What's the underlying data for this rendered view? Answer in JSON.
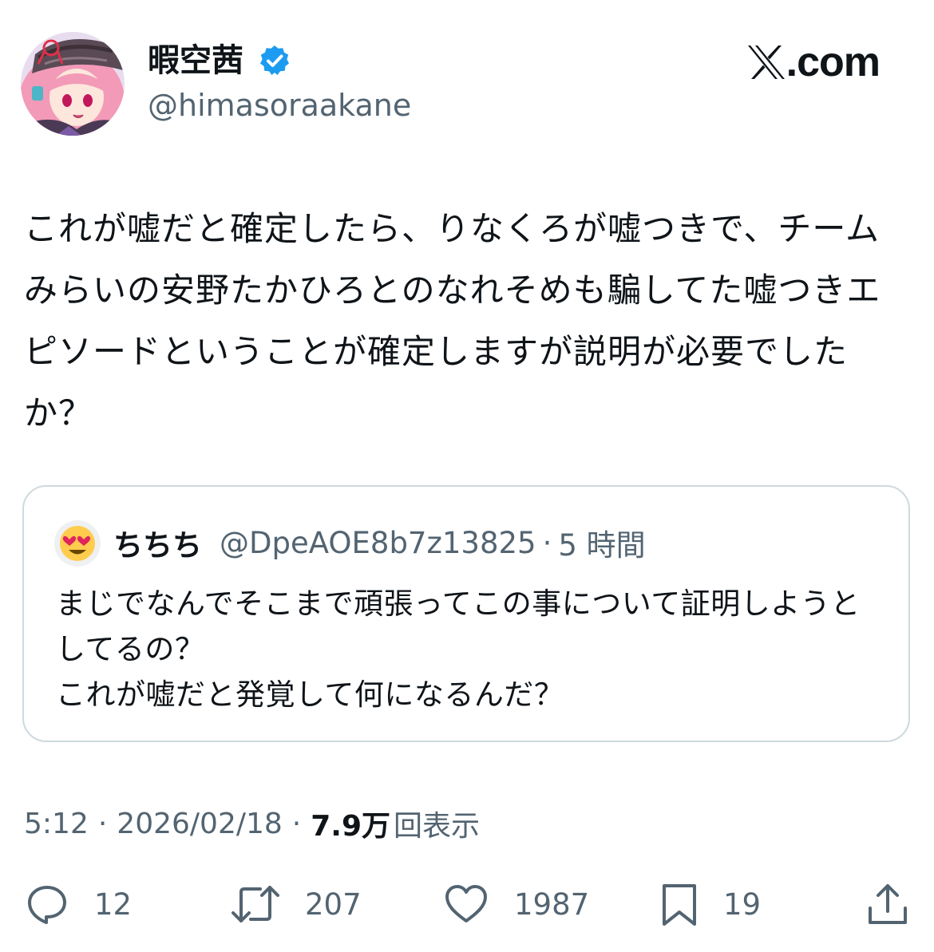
{
  "author": {
    "display_name": "暇空茜",
    "handle": "@himasoraakane",
    "verified": true
  },
  "brand": {
    "text": ".com"
  },
  "tweet": {
    "text": "これが嘘だと確定したら、りなくろが嘘つきで、チームみらいの安野たかひろとのなれそめも騙してた嘘つきエピソードということが確定しますが説明が必要でしたか？"
  },
  "quoted": {
    "display_name": "ちちち",
    "handle": "@DpeAOE8b7z13825",
    "dot": "·",
    "time": "5 時間",
    "avatar_icon": "heart-eyes-emoji",
    "text": "まじでなんでそこまで頑張ってこの事について証明しようとしてるの？\nこれが嘘だと発覚して何になるんだ？"
  },
  "meta": {
    "time": "5:12",
    "sep1": "·",
    "date": "2026/02/18",
    "sep2": "·",
    "views_count": "7.9万",
    "views_label": "回表示"
  },
  "actions": {
    "replies": "12",
    "reposts": "207",
    "likes": "1987",
    "bookmarks": "19"
  },
  "colors": {
    "text": "#0f1419",
    "secondary": "#536471",
    "border": "#cfd9de",
    "verified": "#1d9bf0"
  }
}
